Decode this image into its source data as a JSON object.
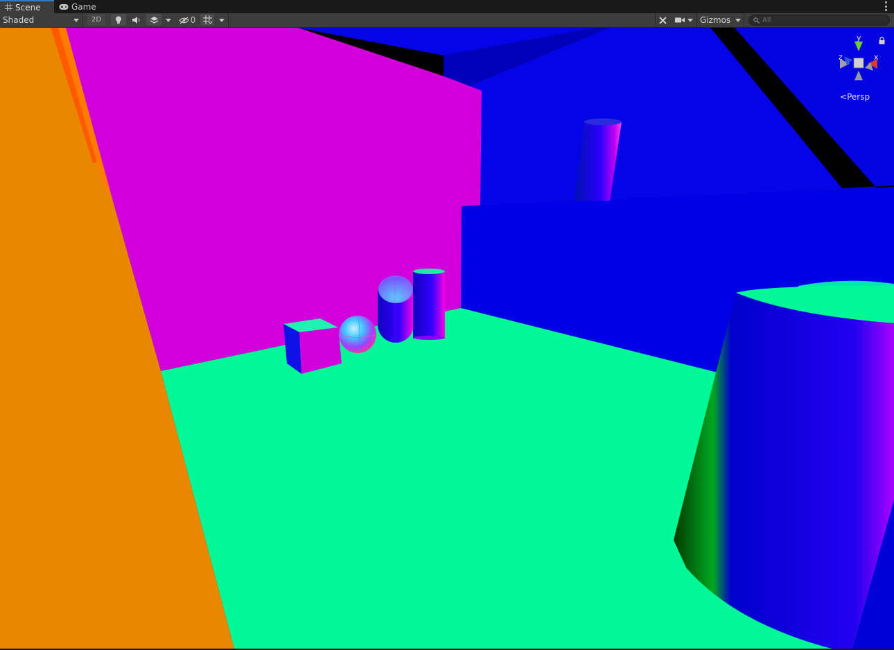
{
  "tabs": [
    {
      "label": "Scene",
      "icon": "grid-icon",
      "active": true
    },
    {
      "label": "Game",
      "icon": "gamepad-icon",
      "active": false
    }
  ],
  "toolbar": {
    "draw_mode": "Shaded",
    "mode_2d": "2D",
    "hidden_count": "0",
    "gizmos": "Gizmos",
    "search_placeholder": "All"
  },
  "viewport": {
    "projection": "Persp",
    "axes": {
      "y": "y",
      "x": "x",
      "z": "z"
    }
  },
  "colors": {
    "accent": "#3a79bb",
    "floor": "#00f996",
    "back_wall": "#d100db",
    "right_wall": "#0000e6",
    "side_wall": "#e98800"
  }
}
